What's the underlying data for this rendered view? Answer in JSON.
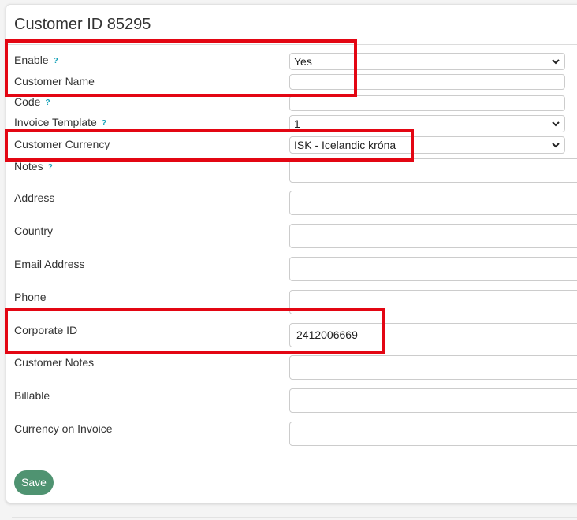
{
  "title": "Customer ID 85295",
  "fields": {
    "enable": {
      "label": "Enable",
      "help": "?",
      "value": "Yes"
    },
    "customer_name": {
      "label": "Customer Name",
      "value": ""
    },
    "code": {
      "label": "Code",
      "help": "?",
      "value": ""
    },
    "invoice_template": {
      "label": "Invoice Template",
      "help": "?",
      "value": "1"
    },
    "customer_currency": {
      "label": "Customer Currency",
      "value": "ISK - Icelandic króna"
    },
    "notes": {
      "label": "Notes",
      "help": "?",
      "value": ""
    },
    "address": {
      "label": "Address",
      "value": ""
    },
    "country": {
      "label": "Country",
      "value": ""
    },
    "email": {
      "label": "Email Address",
      "value": ""
    },
    "phone": {
      "label": "Phone",
      "value": ""
    },
    "corporate_id": {
      "label": "Corporate ID",
      "value": "2412006669"
    },
    "customer_notes": {
      "label": "Customer Notes",
      "value": ""
    },
    "billable": {
      "label": "Billable",
      "value": ""
    },
    "currency_on_invoice": {
      "label": "Currency on Invoice",
      "value": ""
    }
  },
  "buttons": {
    "save": "Save"
  },
  "colors": {
    "highlight": "#e30613",
    "save_button": "#4f9371",
    "help": "#17a2b8"
  }
}
